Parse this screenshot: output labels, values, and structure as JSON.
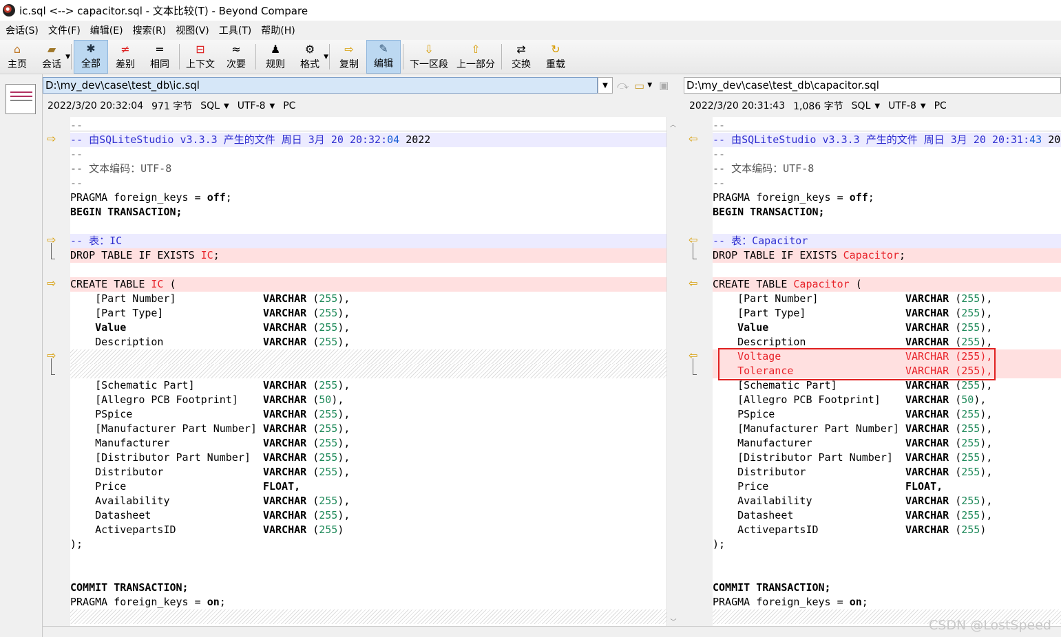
{
  "window": {
    "title": "ic.sql <--> capacitor.sql - 文本比较(T) - Beyond Compare"
  },
  "menu": [
    "会话(S)",
    "文件(F)",
    "编辑(E)",
    "搜索(R)",
    "视图(V)",
    "工具(T)",
    "帮助(H)"
  ],
  "toolbar": {
    "home": "主页",
    "session": "会话",
    "all": "全部",
    "diffs": "差别",
    "same": "相同",
    "context": "上下文",
    "minor": "次要",
    "rules": "规则",
    "format": "格式",
    "copy": "复制",
    "edit": "编辑",
    "next_section": "下一区段",
    "prev_section": "上一部分",
    "swap": "交换",
    "reload": "重载"
  },
  "left": {
    "path": "D:\\my_dev\\case\\test_db\\ic.sql",
    "date": "2022/3/20 20:32:04",
    "size": "971 字节",
    "format": "SQL",
    "encoding": "UTF-8",
    "lineend": "PC",
    "header_time_a": "20:32:",
    "header_time_b": "04",
    "table": "IC"
  },
  "right": {
    "path": "D:\\my_dev\\case\\test_db\\capacitor.sql",
    "date": "2022/3/20 20:31:43",
    "size": "1,086 字节",
    "format": "SQL",
    "encoding": "UTF-8",
    "lineend": "PC",
    "header_time_a": "20:31:",
    "header_time_b": "43",
    "table": "Capacitor"
  },
  "code": {
    "dashes": "--",
    "header_prefix": "-- 由SQLiteStudio v3.3.3 产生的文件 周日 3月 20 ",
    "header_suffix": " 2022",
    "encoding_comment": "-- 文本编码：UTF-8",
    "pragma_off": "PRAGMA foreign_keys = ",
    "off": "off",
    "begin": "BEGIN TRANSACTION;",
    "table_comment": "-- 表：",
    "drop": "DROP TABLE IF EXISTS ",
    "create": "CREATE TABLE ",
    "paren_open": " (",
    "semicolon": ";",
    "commit": "COMMIT TRANSACTION;",
    "on": "on",
    "close": ");",
    "varchar": "VARCHAR",
    "float": "FLOAT,",
    "n255": "255",
    "n50": "50"
  },
  "columns_before": [
    "[Part Number]",
    "[Part Type]",
    "Value",
    "Description"
  ],
  "columns_added": [
    "Voltage",
    "Tolerance"
  ],
  "columns_after": [
    {
      "name": "[Schematic Part]",
      "type": "VARCHAR",
      "size": "255",
      "end": "),"
    },
    {
      "name": "[Allegro PCB Footprint]",
      "type": "VARCHAR",
      "size": "50",
      "end": "),"
    },
    {
      "name": "PSpice",
      "type": "VARCHAR",
      "size": "255",
      "end": "),"
    },
    {
      "name": "[Manufacturer Part Number]",
      "type": "VARCHAR",
      "size": "255",
      "end": "),"
    },
    {
      "name": "Manufacturer",
      "type": "VARCHAR",
      "size": "255",
      "end": "),"
    },
    {
      "name": "[Distributor Part Number]",
      "type": "VARCHAR",
      "size": "255",
      "end": "),"
    },
    {
      "name": "Distributor",
      "type": "VARCHAR",
      "size": "255",
      "end": "),"
    },
    {
      "name": "Price",
      "type": "FLOAT",
      "size": "",
      "end": ","
    },
    {
      "name": "Availability",
      "type": "VARCHAR",
      "size": "255",
      "end": "),"
    },
    {
      "name": "Datasheet",
      "type": "VARCHAR",
      "size": "255",
      "end": "),"
    },
    {
      "name": "ActivepartsID",
      "type": "VARCHAR",
      "size": "255",
      "end": ")"
    }
  ],
  "watermark": "CSDN @LostSpeed"
}
